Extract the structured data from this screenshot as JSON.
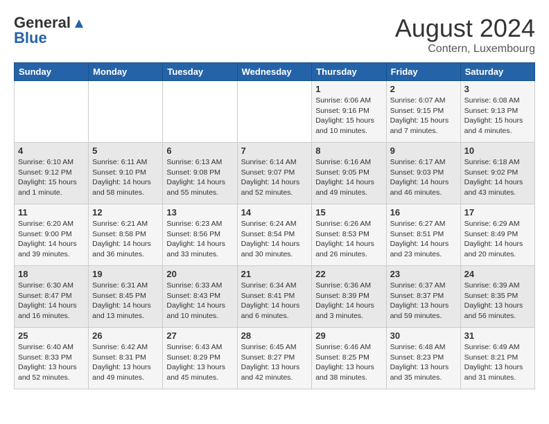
{
  "header": {
    "logo_general": "General",
    "logo_blue": "Blue",
    "title": "August 2024",
    "subtitle": "Contern, Luxembourg"
  },
  "days_of_week": [
    "Sunday",
    "Monday",
    "Tuesday",
    "Wednesday",
    "Thursday",
    "Friday",
    "Saturday"
  ],
  "weeks": [
    [
      {
        "day": "",
        "info": ""
      },
      {
        "day": "",
        "info": ""
      },
      {
        "day": "",
        "info": ""
      },
      {
        "day": "",
        "info": ""
      },
      {
        "day": "1",
        "info": "Sunrise: 6:06 AM\nSunset: 9:16 PM\nDaylight: 15 hours\nand 10 minutes."
      },
      {
        "day": "2",
        "info": "Sunrise: 6:07 AM\nSunset: 9:15 PM\nDaylight: 15 hours\nand 7 minutes."
      },
      {
        "day": "3",
        "info": "Sunrise: 6:08 AM\nSunset: 9:13 PM\nDaylight: 15 hours\nand 4 minutes."
      }
    ],
    [
      {
        "day": "4",
        "info": "Sunrise: 6:10 AM\nSunset: 9:12 PM\nDaylight: 15 hours\nand 1 minute."
      },
      {
        "day": "5",
        "info": "Sunrise: 6:11 AM\nSunset: 9:10 PM\nDaylight: 14 hours\nand 58 minutes."
      },
      {
        "day": "6",
        "info": "Sunrise: 6:13 AM\nSunset: 9:08 PM\nDaylight: 14 hours\nand 55 minutes."
      },
      {
        "day": "7",
        "info": "Sunrise: 6:14 AM\nSunset: 9:07 PM\nDaylight: 14 hours\nand 52 minutes."
      },
      {
        "day": "8",
        "info": "Sunrise: 6:16 AM\nSunset: 9:05 PM\nDaylight: 14 hours\nand 49 minutes."
      },
      {
        "day": "9",
        "info": "Sunrise: 6:17 AM\nSunset: 9:03 PM\nDaylight: 14 hours\nand 46 minutes."
      },
      {
        "day": "10",
        "info": "Sunrise: 6:18 AM\nSunset: 9:02 PM\nDaylight: 14 hours\nand 43 minutes."
      }
    ],
    [
      {
        "day": "11",
        "info": "Sunrise: 6:20 AM\nSunset: 9:00 PM\nDaylight: 14 hours\nand 39 minutes."
      },
      {
        "day": "12",
        "info": "Sunrise: 6:21 AM\nSunset: 8:58 PM\nDaylight: 14 hours\nand 36 minutes."
      },
      {
        "day": "13",
        "info": "Sunrise: 6:23 AM\nSunset: 8:56 PM\nDaylight: 14 hours\nand 33 minutes."
      },
      {
        "day": "14",
        "info": "Sunrise: 6:24 AM\nSunset: 8:54 PM\nDaylight: 14 hours\nand 30 minutes."
      },
      {
        "day": "15",
        "info": "Sunrise: 6:26 AM\nSunset: 8:53 PM\nDaylight: 14 hours\nand 26 minutes."
      },
      {
        "day": "16",
        "info": "Sunrise: 6:27 AM\nSunset: 8:51 PM\nDaylight: 14 hours\nand 23 minutes."
      },
      {
        "day": "17",
        "info": "Sunrise: 6:29 AM\nSunset: 8:49 PM\nDaylight: 14 hours\nand 20 minutes."
      }
    ],
    [
      {
        "day": "18",
        "info": "Sunrise: 6:30 AM\nSunset: 8:47 PM\nDaylight: 14 hours\nand 16 minutes."
      },
      {
        "day": "19",
        "info": "Sunrise: 6:31 AM\nSunset: 8:45 PM\nDaylight: 14 hours\nand 13 minutes."
      },
      {
        "day": "20",
        "info": "Sunrise: 6:33 AM\nSunset: 8:43 PM\nDaylight: 14 hours\nand 10 minutes."
      },
      {
        "day": "21",
        "info": "Sunrise: 6:34 AM\nSunset: 8:41 PM\nDaylight: 14 hours\nand 6 minutes."
      },
      {
        "day": "22",
        "info": "Sunrise: 6:36 AM\nSunset: 8:39 PM\nDaylight: 14 hours\nand 3 minutes."
      },
      {
        "day": "23",
        "info": "Sunrise: 6:37 AM\nSunset: 8:37 PM\nDaylight: 13 hours\nand 59 minutes."
      },
      {
        "day": "24",
        "info": "Sunrise: 6:39 AM\nSunset: 8:35 PM\nDaylight: 13 hours\nand 56 minutes."
      }
    ],
    [
      {
        "day": "25",
        "info": "Sunrise: 6:40 AM\nSunset: 8:33 PM\nDaylight: 13 hours\nand 52 minutes."
      },
      {
        "day": "26",
        "info": "Sunrise: 6:42 AM\nSunset: 8:31 PM\nDaylight: 13 hours\nand 49 minutes."
      },
      {
        "day": "27",
        "info": "Sunrise: 6:43 AM\nSunset: 8:29 PM\nDaylight: 13 hours\nand 45 minutes."
      },
      {
        "day": "28",
        "info": "Sunrise: 6:45 AM\nSunset: 8:27 PM\nDaylight: 13 hours\nand 42 minutes."
      },
      {
        "day": "29",
        "info": "Sunrise: 6:46 AM\nSunset: 8:25 PM\nDaylight: 13 hours\nand 38 minutes."
      },
      {
        "day": "30",
        "info": "Sunrise: 6:48 AM\nSunset: 8:23 PM\nDaylight: 13 hours\nand 35 minutes."
      },
      {
        "day": "31",
        "info": "Sunrise: 6:49 AM\nSunset: 8:21 PM\nDaylight: 13 hours\nand 31 minutes."
      }
    ]
  ]
}
